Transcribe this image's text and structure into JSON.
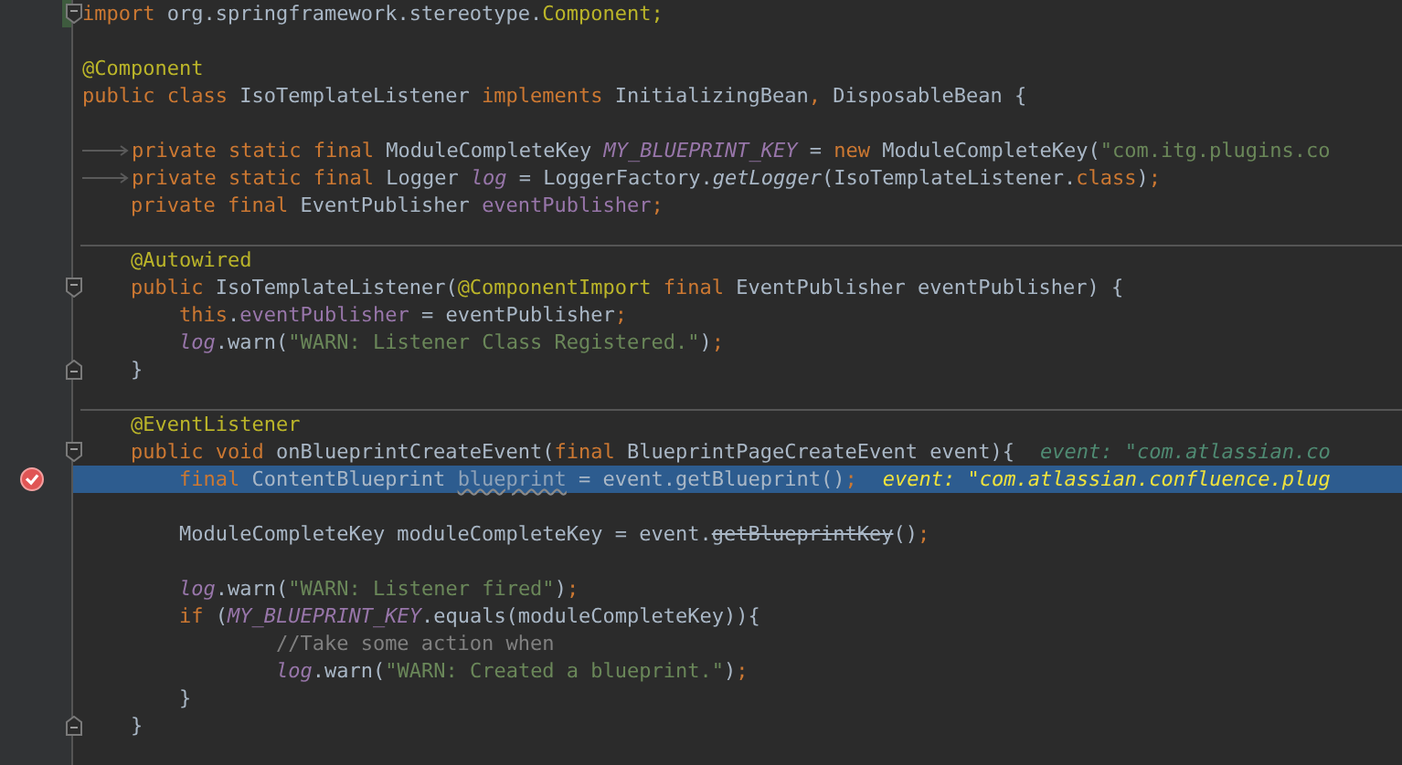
{
  "editor": {
    "lines": [
      {
        "fold_start": true,
        "changed": true,
        "tokens": [
          {
            "kind": "kw",
            "text": "import"
          },
          {
            "kind": "plain",
            "text": " org.springframework.stereotype."
          },
          {
            "kind": "ann",
            "text": "Component;"
          }
        ]
      },
      {
        "blank_above": true,
        "tokens": [
          {
            "kind": "ann",
            "text": "@Component"
          }
        ]
      },
      {
        "tokens": [
          {
            "kind": "kw",
            "text": "public class "
          },
          {
            "kind": "plain",
            "text": "IsoTemplateListener "
          },
          {
            "kind": "kw",
            "text": "implements "
          },
          {
            "kind": "plain",
            "text": "InitializingBean"
          },
          {
            "kind": "kw",
            "text": ", "
          },
          {
            "kind": "plain",
            "text": "DisposableBean {"
          }
        ]
      },
      {
        "blank_above": true,
        "tab": true,
        "tokens": [
          {
            "kind": "kw",
            "text": "private static final "
          },
          {
            "kind": "plain",
            "text": "ModuleCompleteKey "
          },
          {
            "kind": "static",
            "text": "MY_BLUEPRINT_KEY"
          },
          {
            "kind": "plain",
            "text": " = "
          },
          {
            "kind": "kw",
            "text": "new "
          },
          {
            "kind": "plain",
            "text": "ModuleCompleteKey("
          },
          {
            "kind": "string",
            "text": "\"com.itg.plugins.co"
          }
        ]
      },
      {
        "tab": true,
        "tokens": [
          {
            "kind": "kw",
            "text": "private static final "
          },
          {
            "kind": "plain",
            "text": "Logger "
          },
          {
            "kind": "static",
            "text": "log"
          },
          {
            "kind": "plain",
            "text": " = LoggerFactory."
          },
          {
            "kind": "italic",
            "text": "getLogger"
          },
          {
            "kind": "plain",
            "text": "(IsoTemplateListener."
          },
          {
            "kind": "kw",
            "text": "class"
          },
          {
            "kind": "plain",
            "text": ")"
          },
          {
            "kind": "kw",
            "text": ";"
          }
        ]
      },
      {
        "tokens": [
          {
            "kind": "kw",
            "text": "    private final "
          },
          {
            "kind": "plain",
            "text": "EventPublisher "
          },
          {
            "kind": "field",
            "text": "eventPublisher"
          },
          {
            "kind": "kw",
            "text": ";"
          }
        ]
      },
      {
        "blank_above": true,
        "separator_above": true,
        "tokens": [
          {
            "kind": "ann",
            "text": "    @Autowired"
          }
        ]
      },
      {
        "fold_start": true,
        "tokens": [
          {
            "kind": "kw",
            "text": "    public "
          },
          {
            "kind": "plain",
            "text": "IsoTemplateListener("
          },
          {
            "kind": "ann",
            "text": "@ComponentImport "
          },
          {
            "kind": "kw",
            "text": "final "
          },
          {
            "kind": "plain",
            "text": "EventPublisher eventPublisher) {"
          }
        ]
      },
      {
        "tokens": [
          {
            "kind": "kw",
            "text": "        this"
          },
          {
            "kind": "plain",
            "text": "."
          },
          {
            "kind": "field",
            "text": "eventPublisher"
          },
          {
            "kind": "plain",
            "text": " = eventPublisher"
          },
          {
            "kind": "kw",
            "text": ";"
          }
        ]
      },
      {
        "tokens": [
          {
            "kind": "static",
            "text": "        log"
          },
          {
            "kind": "plain",
            "text": ".warn("
          },
          {
            "kind": "string",
            "text": "\"WARN: Listener Class Registered.\""
          },
          {
            "kind": "plain",
            "text": ")"
          },
          {
            "kind": "kw",
            "text": ";"
          }
        ]
      },
      {
        "fold_end": true,
        "tokens": [
          {
            "kind": "plain",
            "text": "    }"
          }
        ]
      },
      {
        "blank_above": true,
        "separator_above": true,
        "tokens": [
          {
            "kind": "ann",
            "text": "    @EventListener"
          }
        ]
      },
      {
        "fold_start": true,
        "hint": "event: \"com.atlassian.co",
        "tokens": [
          {
            "kind": "kw",
            "text": "    public void "
          },
          {
            "kind": "plain",
            "text": "onBlueprintCreateEvent("
          },
          {
            "kind": "kw",
            "text": "final "
          },
          {
            "kind": "plain",
            "text": "BlueprintPageCreateEvent event){"
          }
        ]
      },
      {
        "current": true,
        "breakpoint": true,
        "hint": "event: \"com.atlassian.confluence.plug",
        "tokens": [
          {
            "kind": "kw",
            "text": "        final "
          },
          {
            "kind": "plain",
            "text": "ContentBlueprint "
          },
          {
            "kind": "unused",
            "text": "blueprint"
          },
          {
            "kind": "plain",
            "text": " = event.getBlueprint()"
          },
          {
            "kind": "kw",
            "text": ";"
          }
        ]
      },
      {
        "blank_above": true,
        "tokens": [
          {
            "kind": "plain",
            "text": "        ModuleCompleteKey moduleCompleteKey = event."
          },
          {
            "kind": "deprecated",
            "text": "getBlueprintKey"
          },
          {
            "kind": "plain",
            "text": "()"
          },
          {
            "kind": "kw",
            "text": ";"
          }
        ]
      },
      {
        "blank_above": true,
        "tokens": [
          {
            "kind": "static",
            "text": "        log"
          },
          {
            "kind": "plain",
            "text": ".warn("
          },
          {
            "kind": "string",
            "text": "\"WARN: Listener fired\""
          },
          {
            "kind": "plain",
            "text": ")"
          },
          {
            "kind": "kw",
            "text": ";"
          }
        ]
      },
      {
        "tokens": [
          {
            "kind": "kw",
            "text": "        if "
          },
          {
            "kind": "plain",
            "text": "("
          },
          {
            "kind": "static",
            "text": "MY_BLUEPRINT_KEY"
          },
          {
            "kind": "plain",
            "text": ".equals(moduleCompleteKey)){"
          }
        ]
      },
      {
        "tokens": [
          {
            "kind": "comment",
            "text": "                //Take some action when"
          }
        ]
      },
      {
        "tokens": [
          {
            "kind": "static",
            "text": "                log"
          },
          {
            "kind": "plain",
            "text": ".warn("
          },
          {
            "kind": "string",
            "text": "\"WARN: Created a blueprint.\""
          },
          {
            "kind": "plain",
            "text": ")"
          },
          {
            "kind": "kw",
            "text": ";"
          }
        ]
      },
      {
        "tokens": [
          {
            "kind": "plain",
            "text": "        }"
          }
        ]
      },
      {
        "fold_end": true,
        "tokens": [
          {
            "kind": "plain",
            "text": "    }"
          }
        ]
      }
    ]
  }
}
